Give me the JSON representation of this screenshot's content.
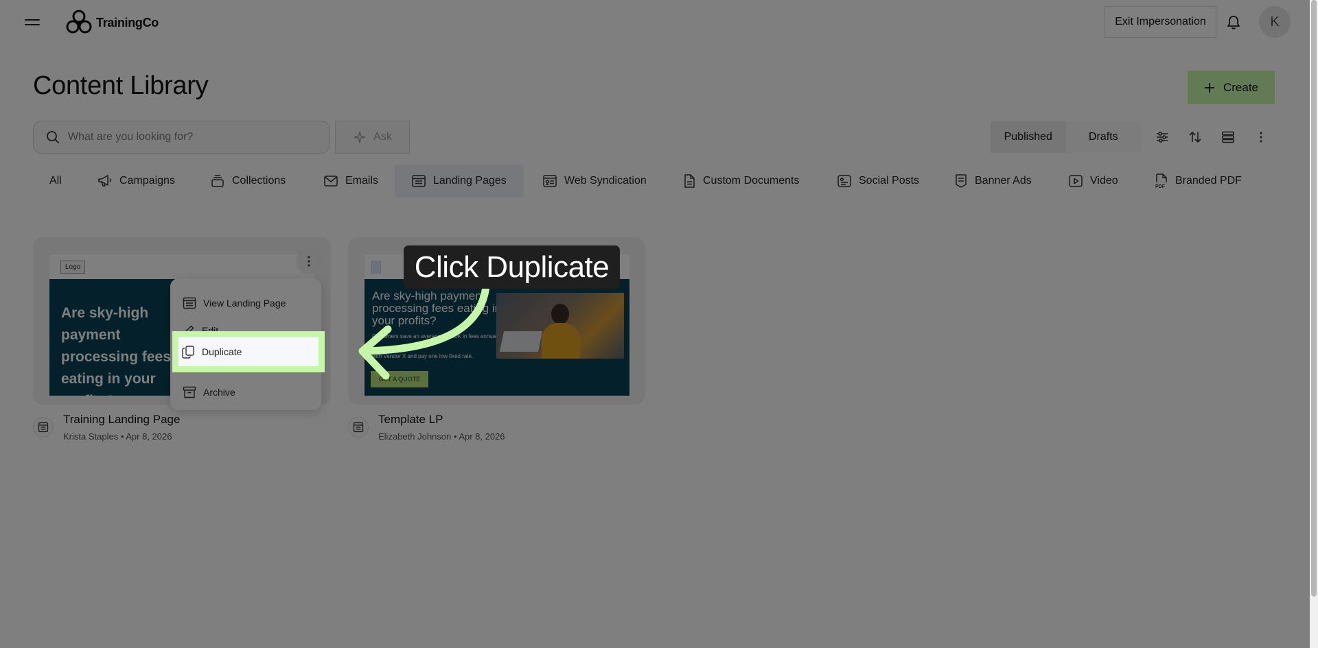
{
  "header": {
    "logo_text": "TrainingCo",
    "exit_label": "Exit Impersonation",
    "avatar_initial": "K"
  },
  "page": {
    "title": "Content Library",
    "create_label": "Create"
  },
  "search": {
    "placeholder": "What are you looking for?",
    "ask_label": "Ask"
  },
  "segment": {
    "published_label": "Published",
    "drafts_label": "Drafts"
  },
  "tabs": [
    {
      "label": "All",
      "icon": "none"
    },
    {
      "label": "Campaigns",
      "icon": "megaphone-icon"
    },
    {
      "label": "Collections",
      "icon": "stack-icon"
    },
    {
      "label": "Emails",
      "icon": "envelope-icon"
    },
    {
      "label": "Landing Pages",
      "icon": "landing-page-icon"
    },
    {
      "label": "Web Syndication",
      "icon": "web-syndication-icon"
    },
    {
      "label": "Custom Documents",
      "icon": "document-icon"
    },
    {
      "label": "Social Posts",
      "icon": "social-post-icon"
    },
    {
      "label": "Banner Ads",
      "icon": "banner-icon"
    },
    {
      "label": "Video",
      "icon": "video-icon"
    },
    {
      "label": "Branded PDF",
      "icon": "pdf-icon"
    }
  ],
  "active_tab": "Landing Pages",
  "cards": [
    {
      "title": "Training Landing Page",
      "author": "Krista Staples",
      "date": "Apr 8, 2026",
      "preview": {
        "logo": "Logo",
        "headline": "Are sky-high payment processing fees eating in your profits?"
      }
    },
    {
      "title": "Template LP",
      "author": "Elizabeth Johnson",
      "date": "Apr 8, 2026",
      "preview": {
        "headline": "Are sky-high payment processing fees eating in your profits?",
        "body_1": "Customers save an average of $30K in fees annually",
        "body_2": "with Vendor X and pay one low fixed rate.",
        "cta": "GET A QUOTE"
      }
    }
  ],
  "menu": {
    "items": [
      "View Landing Page",
      "Edit",
      "Duplicate",
      "Archive"
    ],
    "highlighted": "Duplicate"
  },
  "callout": {
    "text": "Click Duplicate"
  },
  "colors": {
    "accent_green": "#c6f7a8",
    "hero_teal": "#094357",
    "cta_green": "#b9e07a"
  }
}
